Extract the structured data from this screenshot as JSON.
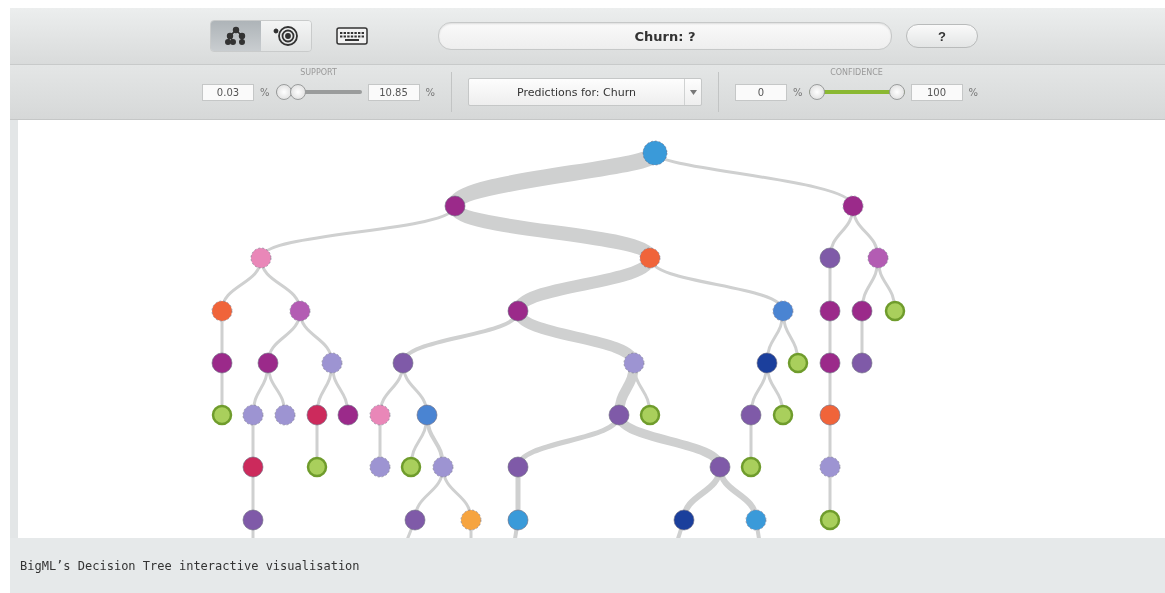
{
  "toolbar": {
    "view_buttons": [
      {
        "kind": "tree",
        "selected": true
      },
      {
        "kind": "sunburst",
        "selected": false
      }
    ],
    "prediction": "Churn: ?",
    "help_button": "?"
  },
  "filters": {
    "support": {
      "label": "SUPPORT",
      "min": {
        "value": "0.03",
        "unit": "%"
      },
      "max": {
        "value": "10.85",
        "unit": "%"
      },
      "level": 0.2
    },
    "select": "Predictions for: Churn",
    "confidence": {
      "label": "CONFIDENCE",
      "min": {
        "value": "0",
        "unit": "%"
      },
      "max": {
        "value": "100",
        "unit": "%"
      },
      "level": 1
    }
  },
  "caption": "BigML’s Decision Tree interactive visualisation"
}
